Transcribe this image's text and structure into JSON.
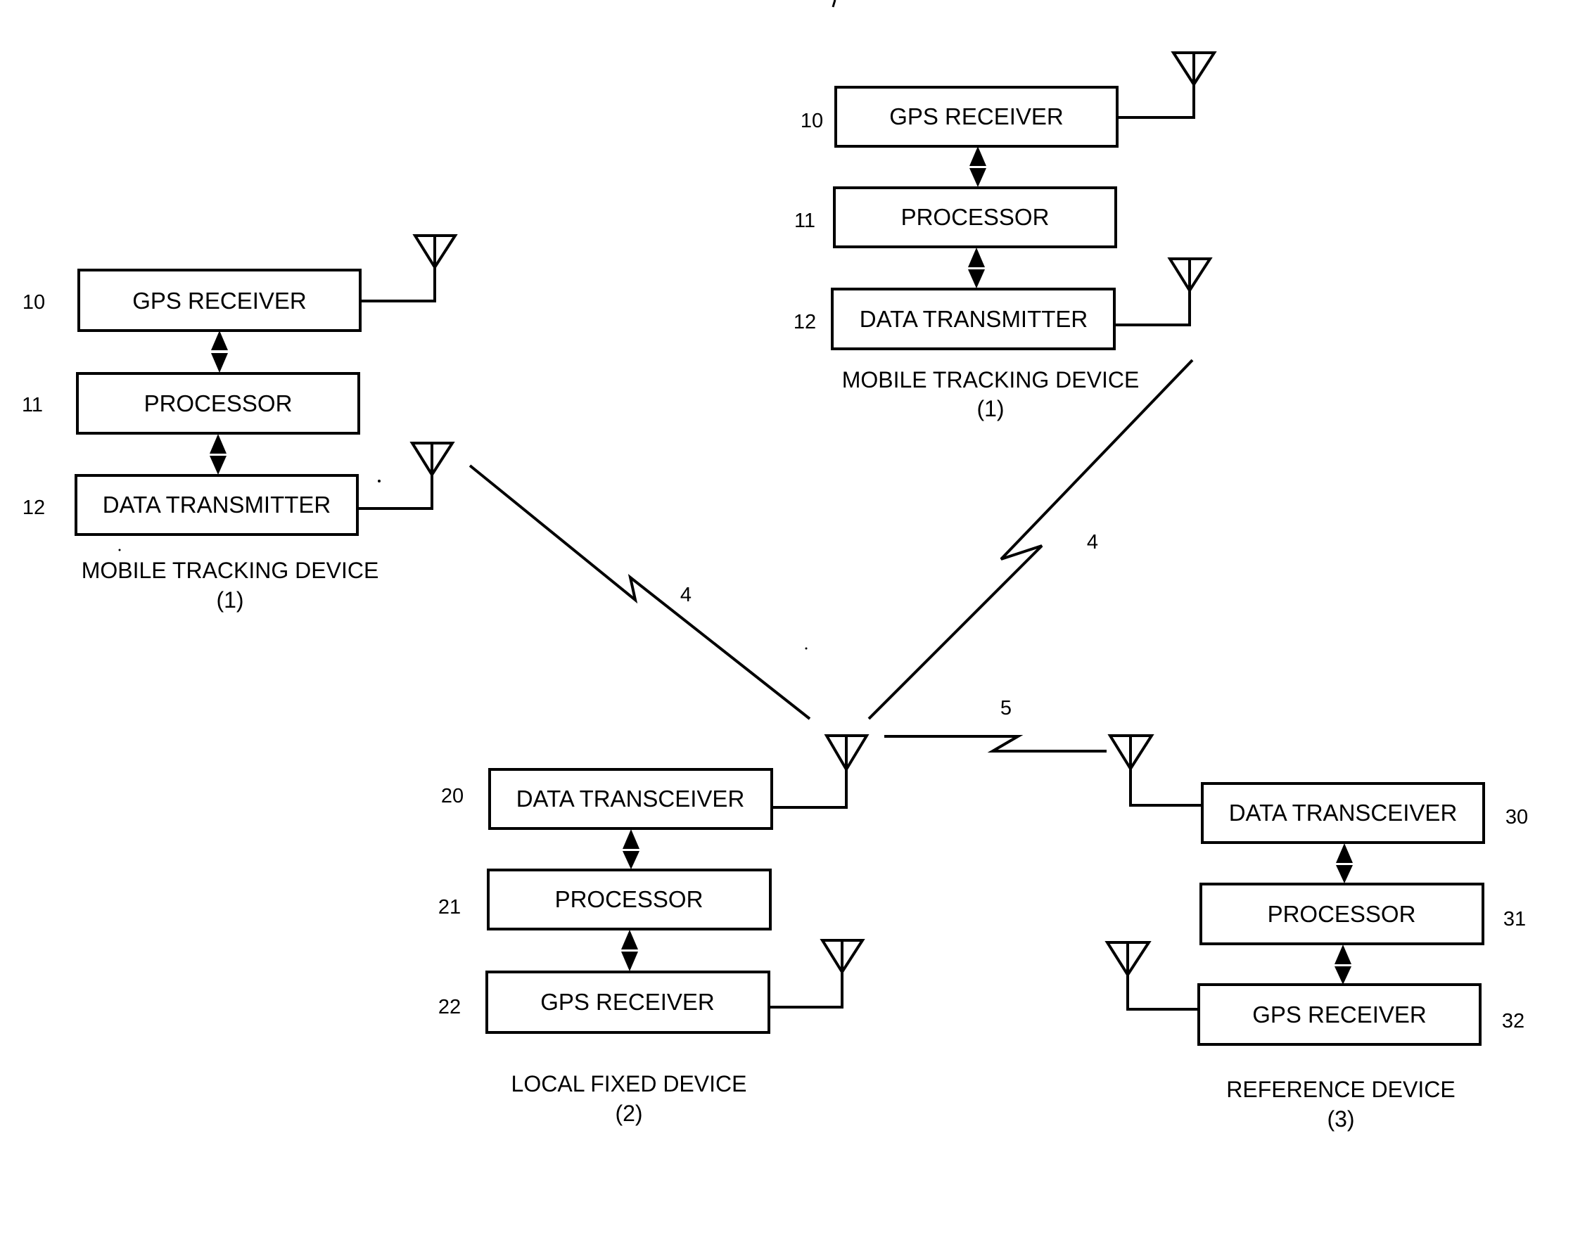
{
  "figure": {
    "type": "block-diagram",
    "description": "GPS tracking system block diagram"
  },
  "devices": [
    {
      "id": "mobile-left",
      "caption": "MOBILE TRACKING DEVICE",
      "caption_number": "(1)",
      "blocks": [
        {
          "ref": "10",
          "label": "GPS RECEIVER",
          "antenna": true
        },
        {
          "ref": "11",
          "label": "PROCESSOR",
          "antenna": false
        },
        {
          "ref": "12",
          "label": "DATA TRANSMITTER",
          "antenna": true
        }
      ]
    },
    {
      "id": "mobile-right",
      "caption": "MOBILE TRACKING DEVICE",
      "caption_number": "(1)",
      "blocks": [
        {
          "ref": "10",
          "label": "GPS RECEIVER",
          "antenna": true
        },
        {
          "ref": "11",
          "label": "PROCESSOR",
          "antenna": false
        },
        {
          "ref": "12",
          "label": "DATA TRANSMITTER",
          "antenna": true
        }
      ]
    },
    {
      "id": "local-fixed",
      "caption": "LOCAL FIXED DEVICE",
      "caption_number": "(2)",
      "blocks": [
        {
          "ref": "20",
          "label": "DATA TRANSCEIVER",
          "antenna": true
        },
        {
          "ref": "21",
          "label": "PROCESSOR",
          "antenna": false
        },
        {
          "ref": "22",
          "label": "GPS RECEIVER",
          "antenna": true
        }
      ]
    },
    {
      "id": "reference",
      "caption": "REFERENCE DEVICE",
      "caption_number": "(3)",
      "blocks": [
        {
          "ref": "30",
          "label": "DATA TRANSCEIVER",
          "antenna": true
        },
        {
          "ref": "31",
          "label": "PROCESSOR",
          "antenna": false
        },
        {
          "ref": "32",
          "label": "GPS RECEIVER",
          "antenna": true
        }
      ]
    }
  ],
  "links": [
    {
      "ref": "4",
      "from": "mobile-left",
      "to": "local-fixed",
      "kind": "wireless"
    },
    {
      "ref": "4",
      "from": "mobile-right",
      "to": "local-fixed",
      "kind": "wireless"
    },
    {
      "ref": "5",
      "from": "local-fixed",
      "to": "reference",
      "kind": "wireless"
    }
  ]
}
